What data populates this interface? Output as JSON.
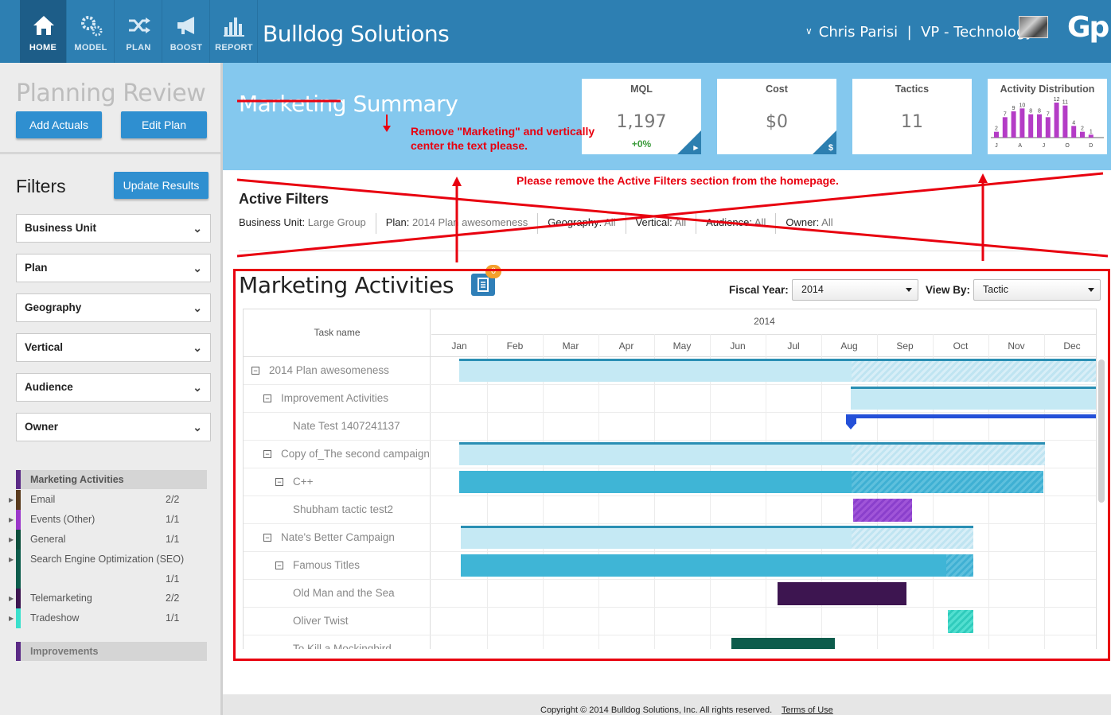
{
  "nav": [
    {
      "label": "HOME",
      "icon": "home-icon",
      "active": true
    },
    {
      "label": "MODEL",
      "icon": "gears-icon",
      "active": false
    },
    {
      "label": "PLAN",
      "icon": "shuffle-icon",
      "active": false
    },
    {
      "label": "BOOST",
      "icon": "megaphone-icon",
      "active": false
    },
    {
      "label": "REPORT",
      "icon": "bar-chart-icon",
      "active": false
    }
  ],
  "header": {
    "app_title": "Bulldog Solutions",
    "user": "Chris Parisi  |  VP - Technology1",
    "logo": "Gp"
  },
  "sidebar": {
    "title": "Planning Review",
    "add_actuals": "Add Actuals",
    "edit_plan": "Edit Plan",
    "filters_title": "Filters",
    "update_results": "Update Results",
    "dropdowns": [
      "Business Unit",
      "Plan",
      "Geography",
      "Vertical",
      "Audience",
      "Owner"
    ],
    "legend_title": "Marketing Activities",
    "legend": [
      {
        "name": "Email",
        "count": "2/2",
        "color": "#5a3b1e"
      },
      {
        "name": "Events (Other)",
        "count": "1/1",
        "color": "#9b37c9"
      },
      {
        "name": "General",
        "count": "1/1",
        "color": "#0d4f3c"
      },
      {
        "name": "Search Engine Optimization (SEO)",
        "count": "1/1",
        "color": "#0d5c4c"
      },
      {
        "name": "Telemarketing",
        "count": "2/2",
        "color": "#3d1550"
      },
      {
        "name": "Tradeshow",
        "count": "1/1",
        "color": "#3ae0cc"
      }
    ],
    "improvements_title": "Improvements"
  },
  "summary": {
    "title": "Marketing Summary",
    "cards": {
      "mql": {
        "title": "MQL",
        "value": "1,197",
        "sub": "+0%"
      },
      "cost": {
        "title": "Cost",
        "value": "$0",
        "corner": "$"
      },
      "tactics": {
        "title": "Tactics",
        "value": "11"
      },
      "dist": {
        "title": "Activity Distribution",
        "values": [
          2,
          7,
          9,
          10,
          8,
          8,
          7,
          12,
          11,
          4,
          2,
          1
        ],
        "axis_labels": [
          "J",
          "A",
          "J",
          "O",
          "D"
        ],
        "bar_color": "#b43cc6"
      }
    }
  },
  "annotations": {
    "note1": "Remove \"Marketing\" and vertically center the text please.",
    "note2": "Please remove the Active Filters section from the homepage.",
    "color": "#e8000f"
  },
  "active_filters": {
    "title": "Active Filters",
    "items": [
      {
        "label": "Business Unit:",
        "value": "Large Group"
      },
      {
        "label": "Plan:",
        "value": "2014 Plan awesomeness"
      },
      {
        "label": "Geography:",
        "value": "All"
      },
      {
        "label": "Vertical:",
        "value": "All"
      },
      {
        "label": "Audience:",
        "value": "All"
      },
      {
        "label": "Owner:",
        "value": "All"
      }
    ]
  },
  "activities": {
    "title": "Marketing Activities",
    "badge": "0",
    "fiscal_year_label": "Fiscal Year:",
    "fiscal_year": "2014",
    "view_by_label": "View By:",
    "view_by": "Tactic"
  },
  "gantt": {
    "task_header": "Task name",
    "year": "2014",
    "months": [
      "Jan",
      "Feb",
      "Mar",
      "Apr",
      "May",
      "Jun",
      "Jul",
      "Aug",
      "Sep",
      "Oct",
      "Nov",
      "Dec"
    ],
    "rows": [
      {
        "label": "2014 Plan awesomeness",
        "level": 0,
        "toggle": true
      },
      {
        "label": "Improvement Activities",
        "level": 1,
        "toggle": true
      },
      {
        "label": "Nate Test 1407241137",
        "level": 2,
        "toggle": false
      },
      {
        "label": "Copy of_The second campaign",
        "level": 1,
        "toggle": true
      },
      {
        "label": "C++",
        "level": 2,
        "toggle": true
      },
      {
        "label": "Shubham tactic test2",
        "level": 3,
        "toggle": false
      },
      {
        "label": "Nate's Better Campaign",
        "level": 1,
        "toggle": true
      },
      {
        "label": "Famous Titles",
        "level": 2,
        "toggle": true
      },
      {
        "label": "Old Man and the Sea",
        "level": 3,
        "toggle": false
      },
      {
        "label": "Oliver Twist",
        "level": 3,
        "toggle": false
      },
      {
        "label": "To Kill a Mockingbird",
        "level": 3,
        "toggle": false
      }
    ]
  },
  "footer": {
    "copyright": "Copyright © 2014 Bulldog Solutions, Inc. All rights reserved.",
    "terms": "Terms of Use"
  }
}
